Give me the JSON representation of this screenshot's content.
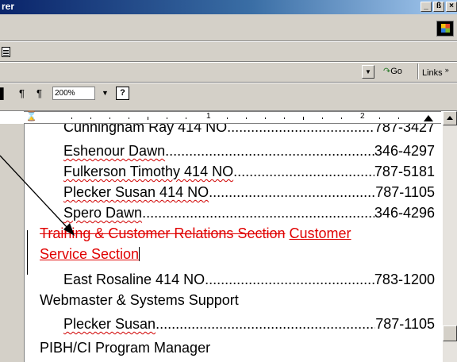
{
  "window": {
    "title_fragment": "rer",
    "min_label": "_",
    "max_label": "ß",
    "close_label": "×"
  },
  "address_bar": {
    "go_label": "Go",
    "links_label": "Links",
    "links_arrow": "»"
  },
  "format_toolbar": {
    "pilcrow_1": "¶",
    "pilcrow_2": "¶",
    "zoom": "200%",
    "help_label": "?"
  },
  "ruler": {
    "numbers": [
      "1",
      "2"
    ]
  },
  "document": {
    "entries": [
      {
        "name": "Cunningham Ray 414 NO",
        "phone": "787-3427",
        "squiggle": false
      },
      {
        "name": "Eshenour Dawn",
        "phone": "346-4297",
        "squiggle": true
      },
      {
        "name": "Fulkerson Timothy 414 NO",
        "phone": "787-5181",
        "squiggle": true
      },
      {
        "name": "Plecker Susan 414 NO",
        "phone": "787-1105",
        "squiggle": true
      },
      {
        "name": "Spero Dawn",
        "phone": "346-4296",
        "squiggle": false
      }
    ],
    "deleted_text": "Training & Customer Relations Section",
    "inserted_text_1": "Customer",
    "inserted_text_2": "Service Section",
    "entry_east": {
      "name": "East Rosaline 414 NO",
      "phone": "783-1200"
    },
    "heading_webmaster": "Webmaster & Systems Support",
    "entry_plecker": {
      "name": "Plecker Susan",
      "phone": "787-1105"
    },
    "heading_pibh": "PIBH/CI Program Manager"
  },
  "colors": {
    "revision": "#e00000",
    "chrome": "#d4d0c8",
    "titlebar": "#0a246a"
  }
}
